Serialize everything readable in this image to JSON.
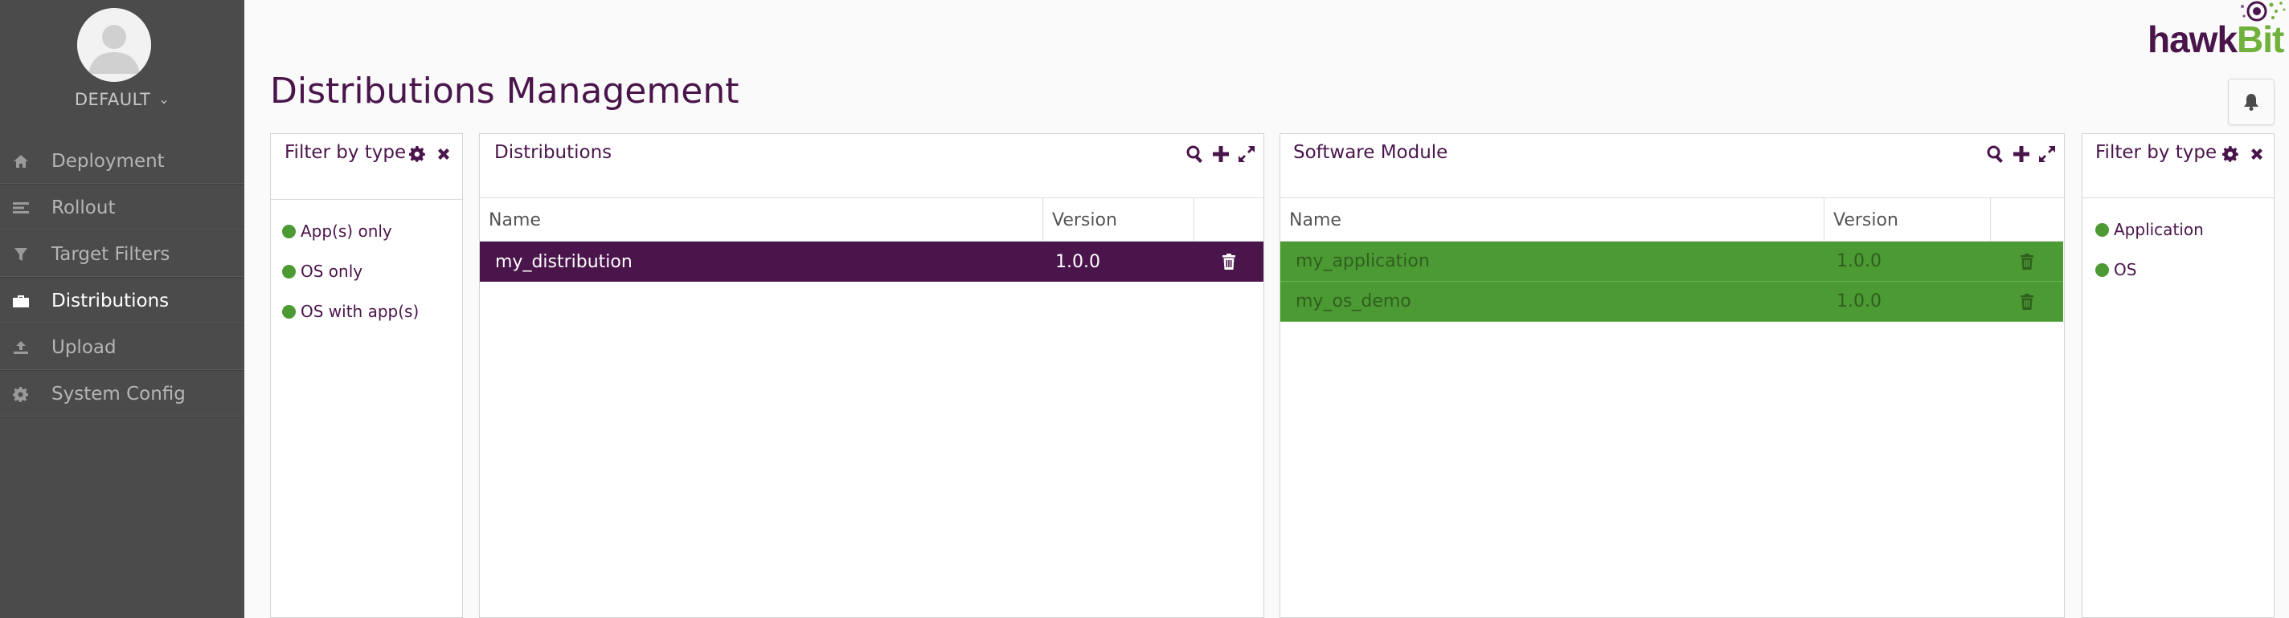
{
  "sidebar": {
    "tenant": "DEFAULT",
    "items": [
      {
        "label": "Deployment",
        "icon": "home-icon",
        "active": false
      },
      {
        "label": "Rollout",
        "icon": "list-icon",
        "active": false
      },
      {
        "label": "Target Filters",
        "icon": "filter-icon",
        "active": false
      },
      {
        "label": "Distributions",
        "icon": "briefcase-icon",
        "active": true
      },
      {
        "label": "Upload",
        "icon": "upload-icon",
        "active": false
      },
      {
        "label": "System Config",
        "icon": "gear-icon",
        "active": false
      }
    ]
  },
  "header": {
    "title": "Distributions Management",
    "logo_hawk": "hawk",
    "logo_bit": "Bit"
  },
  "dist_type_filter": {
    "title": "Filter by type",
    "items": [
      "App(s) only",
      "OS only",
      "OS with app(s)"
    ]
  },
  "distributions": {
    "title": "Distributions",
    "columns": {
      "name": "Name",
      "version": "Version"
    },
    "rows": [
      {
        "name": "my_distribution",
        "version": "1.0.0"
      }
    ]
  },
  "software_module": {
    "title": "Software Module",
    "columns": {
      "name": "Name",
      "version": "Version"
    },
    "rows": [
      {
        "name": "my_application",
        "version": "1.0.0"
      },
      {
        "name": "my_os_demo",
        "version": "1.0.0"
      }
    ]
  },
  "sm_type_filter": {
    "title": "Filter by type",
    "items": [
      "Application",
      "OS"
    ]
  },
  "colors": {
    "brand_purple": "#4a154b",
    "brand_green": "#4c9a33",
    "sidebar_bg": "#4b4b4b"
  }
}
